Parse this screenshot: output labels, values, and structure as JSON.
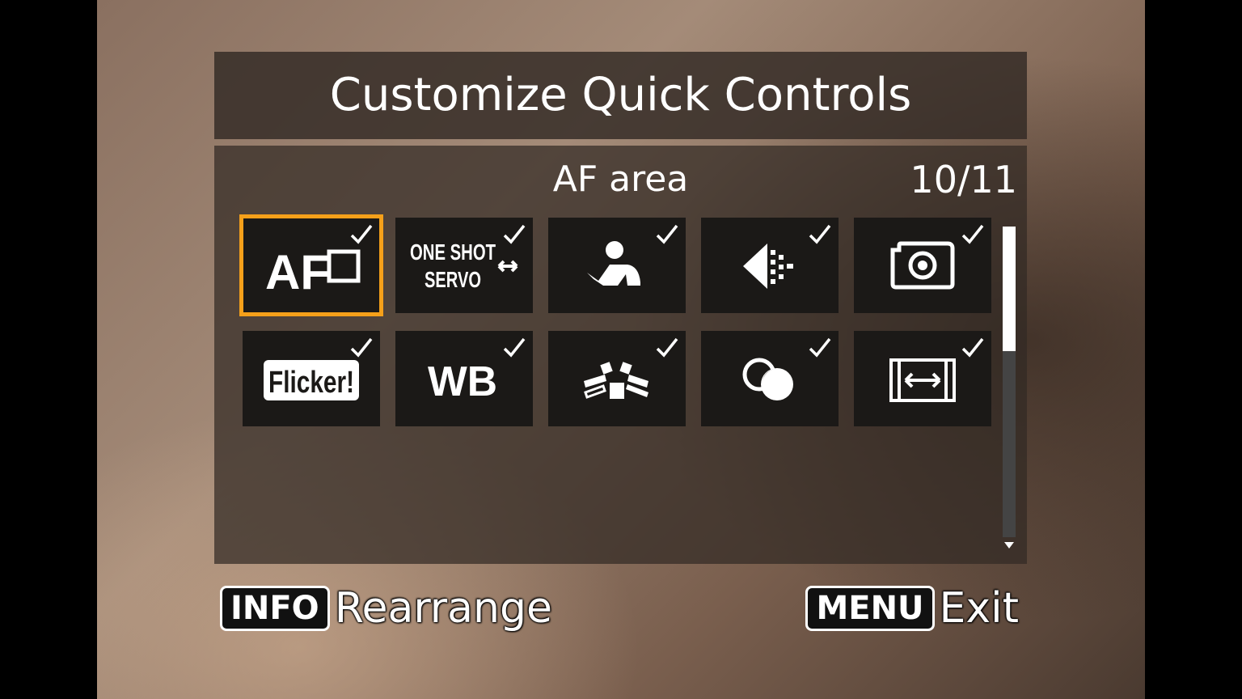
{
  "title": "Customize Quick Controls",
  "current_item": "AF area",
  "page_counter": "10/11",
  "tiles": [
    {
      "icon": "af-area-icon",
      "label": "AF",
      "checked": true,
      "selected": true
    },
    {
      "icon": "af-operation-icon",
      "label_line1": "ONE SHOT",
      "label_line2": "SERVO",
      "checked": true
    },
    {
      "icon": "subject-detection-icon",
      "checked": true
    },
    {
      "icon": "eye-detection-icon",
      "checked": true
    },
    {
      "icon": "metering-mode-icon",
      "checked": true
    },
    {
      "icon": "flicker-icon",
      "label": "Flicker!",
      "checked": true
    },
    {
      "icon": "white-balance-icon",
      "label": "WB",
      "checked": true
    },
    {
      "icon": "picture-style-icon",
      "checked": true
    },
    {
      "icon": "creative-filter-icon",
      "checked": true
    },
    {
      "icon": "aspect-ratio-icon",
      "checked": true
    }
  ],
  "scrollbar": {
    "position_fraction": 0.0,
    "visible_fraction": 0.4
  },
  "footer": {
    "left_key": "INFO",
    "left_action": "Rearrange",
    "right_key": "MENU",
    "right_action": "Exit"
  },
  "colors": {
    "selection": "#f5a01a",
    "tile_bg": "#1b1917",
    "panel_bg": "#322a24"
  }
}
